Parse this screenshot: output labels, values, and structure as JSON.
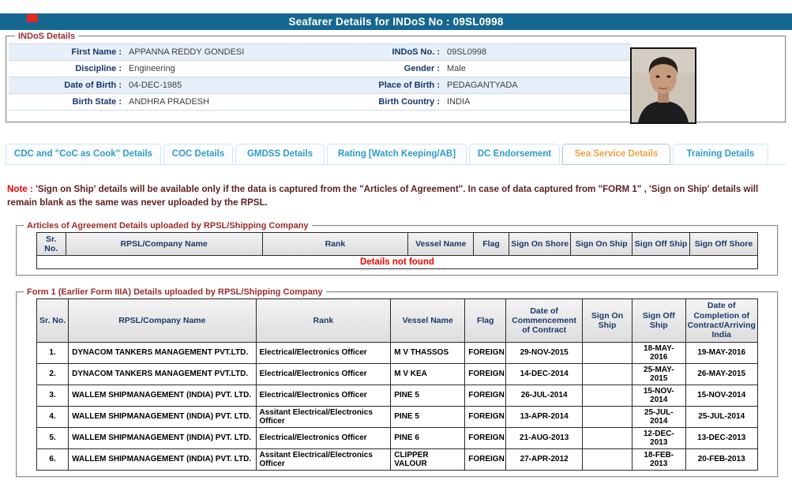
{
  "colors": {
    "header_bar": "#16678F",
    "label_navy": "#17366E",
    "legend_maroon": "#9C2B2B",
    "tab_blue": "#2E9CC8",
    "tab_active_orange": "#ECA13F",
    "note_maroon": "#5D2121",
    "alert_red": "#F50000",
    "row_stripe_blue": "#E7F0F9"
  },
  "page_title": "Seafarer Details for INDoS No : 09SL0998",
  "indos": {
    "legend": "INDoS Details",
    "rows": [
      {
        "l1": "First Name :",
        "v1": "APPANNA REDDY GONDESI",
        "l2": "INDoS No. :",
        "v2": "09SL0998"
      },
      {
        "l1": "Discipline :",
        "v1": "Engineering",
        "l2": "Gender :",
        "v2": "Male"
      },
      {
        "l1": "Date of Birth :",
        "v1": "04-DEC-1985",
        "l2": "Place of Birth :",
        "v2": "PEDAGANTYADA"
      },
      {
        "l1": "Birth State :",
        "v1": "ANDHRA PRADESH",
        "l2": "Birth Country :",
        "v2": "INDIA"
      }
    ],
    "photo_icon": "seafarer-photo"
  },
  "tabs": [
    {
      "label": "CDC and \"CoC as Cook\" Details",
      "active": false
    },
    {
      "label": "COC Details",
      "active": false
    },
    {
      "label": "GMDSS Details",
      "active": false
    },
    {
      "label": "Rating [Watch Keeping/AB]",
      "active": false
    },
    {
      "label": "DC Endorsement",
      "active": false
    },
    {
      "label": "Sea Service Details",
      "active": true
    },
    {
      "label": "Training Details",
      "active": false
    }
  ],
  "note": {
    "prefix": "Note :",
    "text": " 'Sign on Ship' details will be available only if the data is captured from the \"Articles of Agreement\". In case of data captured from \"FORM 1\" , 'Sign on Ship' details will remain blank as the same was never uploaded by the RPSL."
  },
  "articles": {
    "legend": "Articles of Agreement Details uploaded by RPSL/Shipping Company",
    "headers": [
      "Sr. No.",
      "RPSL/Company Name",
      "Rank",
      "Vessel Name",
      "Flag",
      "Sign On Shore",
      "Sign On Ship",
      "Sign Off Ship",
      "Sign Off Shore"
    ],
    "empty_message": "Details not found"
  },
  "form1": {
    "legend": "Form 1 (Earlier Form IIIA) Details uploaded by RPSL/Shipping Company",
    "headers": [
      "Sr. No.",
      "RPSL/Company Name",
      "Rank",
      "Vessel Name",
      "Flag",
      "Date of Commencement of Contract",
      "Sign On Ship",
      "Sign Off Ship",
      "Date of Completion of Contract/Arriving India"
    ],
    "rows": [
      [
        "1.",
        "DYNACOM TANKERS MANAGEMENT PVT.LTD.",
        "Electrical/Electronics Officer",
        "M V THASSOS",
        "FOREIGN",
        "29-NOV-2015",
        "",
        "18-MAY-2016",
        "19-MAY-2016"
      ],
      [
        "2.",
        "DYNACOM TANKERS MANAGEMENT PVT.LTD.",
        "Electrical/Electronics Officer",
        "M V KEA",
        "FOREIGN",
        "14-DEC-2014",
        "",
        "25-MAY-2015",
        "26-MAY-2015"
      ],
      [
        "3.",
        "WALLEM SHIPMANAGEMENT (INDIA) PVT. LTD.",
        "Electrical/Electronics Officer",
        "PINE 5",
        "FOREIGN",
        "26-JUL-2014",
        "",
        "15-NOV-2014",
        "15-NOV-2014"
      ],
      [
        "4.",
        "WALLEM SHIPMANAGEMENT (INDIA) PVT. LTD.",
        "Assitant Electrical/Electronics Officer",
        "PINE 5",
        "FOREIGN",
        "13-APR-2014",
        "",
        "25-JUL-2014",
        "25-JUL-2014"
      ],
      [
        "5.",
        "WALLEM SHIPMANAGEMENT (INDIA) PVT. LTD.",
        "Electrical/Electronics Officer",
        "PINE 6",
        "FOREIGN",
        "21-AUG-2013",
        "",
        "12-DEC-2013",
        "13-DEC-2013"
      ],
      [
        "6.",
        "WALLEM SHIPMANAGEMENT (INDIA) PVT. LTD.",
        "Assitant Electrical/Electronics Officer",
        "CLIPPER VALOUR",
        "FOREIGN",
        "27-APR-2012",
        "",
        "18-FEB-2013",
        "20-FEB-2013"
      ]
    ]
  }
}
